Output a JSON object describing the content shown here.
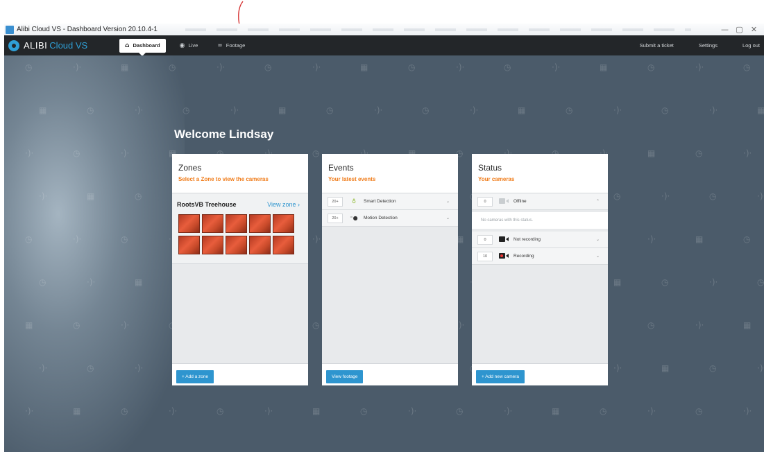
{
  "window": {
    "title": "Alibi Cloud VS - Dashboard  Version 20.10.4-1",
    "buttons": {
      "minimize": "—",
      "maximize": "▢",
      "close": "✕"
    }
  },
  "app": {
    "logo_primary": "ALIBI",
    "logo_secondary": "Cloud VS",
    "nav": [
      {
        "label": "Dashboard",
        "icon": "home-icon",
        "active": true
      },
      {
        "label": "Live",
        "icon": "eye-icon",
        "active": false
      },
      {
        "label": "Footage",
        "icon": "binoculars-icon",
        "active": false
      }
    ],
    "right_links": [
      "Submit a ticket",
      "Settings",
      "Log out"
    ]
  },
  "welcome": "Welcome Lindsay",
  "zones": {
    "title": "Zones",
    "subtitle": "Select a Zone to view the cameras",
    "zone_name": "RootsVB Treehouse",
    "view_zone": "View zone",
    "view_zone_chevron": "›",
    "thumbnail_count": 10,
    "add_button": "+ Add a zone"
  },
  "events": {
    "title": "Events",
    "subtitle": "Your latest events",
    "items": [
      {
        "count": "20+",
        "icon": "bulb-icon",
        "label": "Smart Detection"
      },
      {
        "count": "20+",
        "icon": "motion-icon",
        "label": "Motion Detection"
      }
    ],
    "footer_button": "View footage"
  },
  "status": {
    "title": "Status",
    "subtitle": "Your cameras",
    "items": [
      {
        "count": "0",
        "label": "Offline",
        "expanded": true
      },
      {
        "count": "0",
        "label": "Not recording",
        "expanded": false
      },
      {
        "count": "10",
        "label": "Recording",
        "expanded": false
      }
    ],
    "empty_note": "No cameras with this status.",
    "add_button": "+ Add new camera"
  },
  "colors": {
    "accent_blue": "#2e95cf",
    "accent_orange": "#f07c1a",
    "header_dark": "#232629",
    "background": "#4b5b6a",
    "annotation_red": "#d42a2a"
  }
}
